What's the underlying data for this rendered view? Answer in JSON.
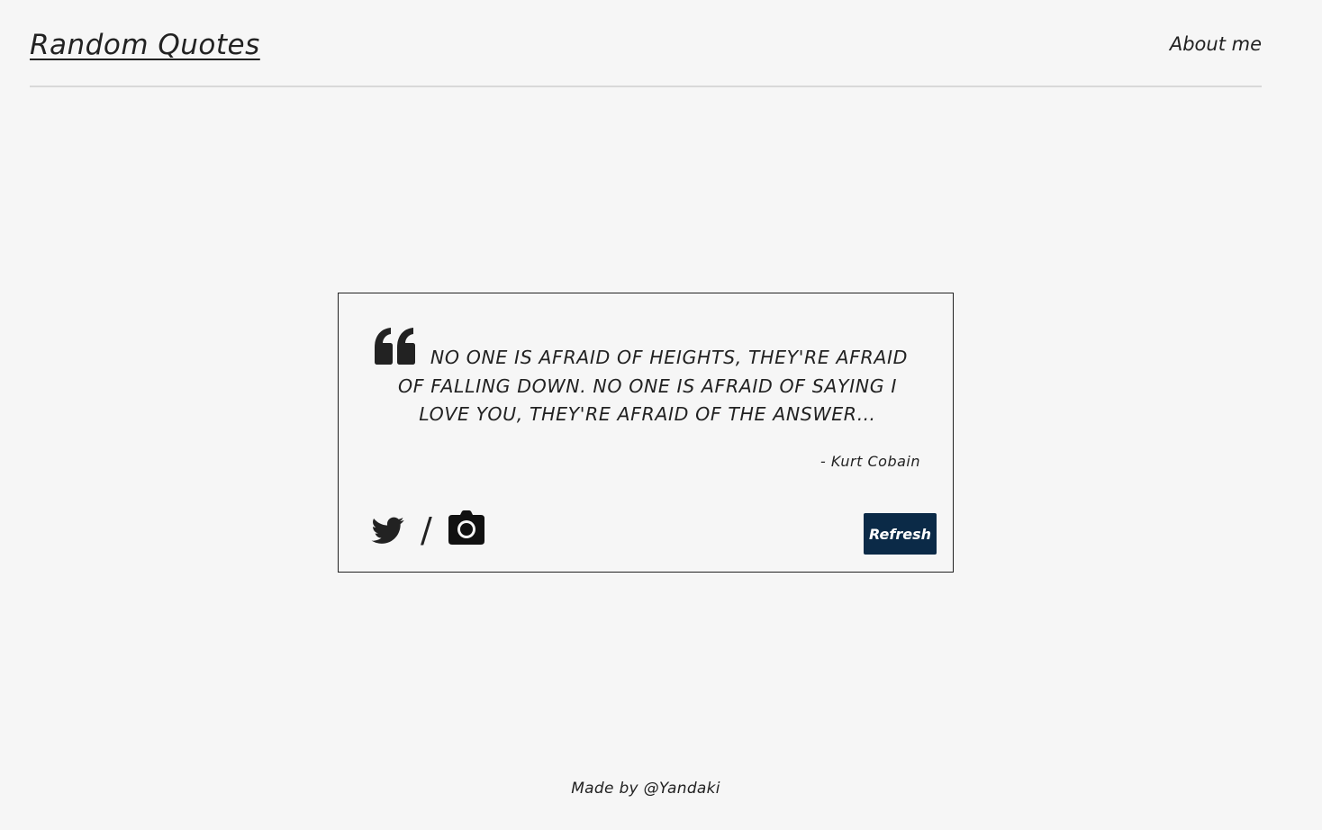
{
  "header": {
    "brand": "Random Quotes",
    "nav_about": "About me"
  },
  "quote": {
    "text": "No one is afraid of heights, they're afraid of falling down. No one is afraid of saying I love you, they're afraid of the answer…",
    "author": "- Kurt Cobain",
    "separator": "/",
    "refresh_label": "Refresh",
    "icons": {
      "quote_mark": "quote-left-icon",
      "share": "twitter-icon",
      "screenshot": "camera-icon"
    }
  },
  "footer": {
    "credit": "Made by @Yandaki"
  },
  "colors": {
    "background": "#f6f6f6",
    "text": "#222222",
    "button": "#0b2a47",
    "divider": "#d9d9d9"
  }
}
